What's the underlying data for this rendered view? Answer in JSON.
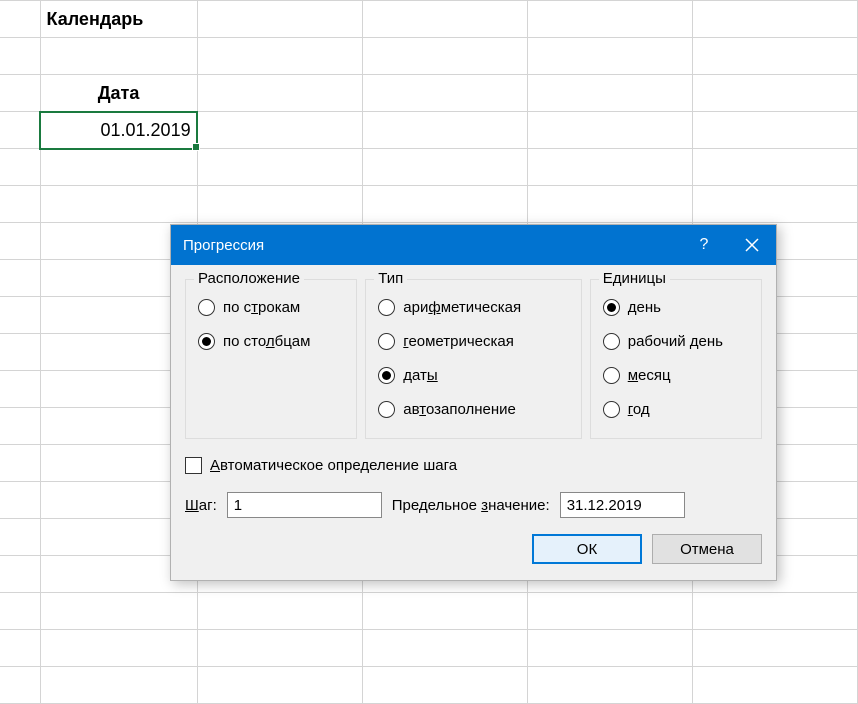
{
  "sheet": {
    "title": "Календарь",
    "header": "Дата",
    "value": "01.01.2019"
  },
  "dialog": {
    "title": "Прогрессия",
    "help": "?",
    "groups": {
      "location": {
        "legend": "Расположение",
        "rows_pre": "по с",
        "rows_u": "т",
        "rows_post": "рокам",
        "cols_pre": "по сто",
        "cols_u": "л",
        "cols_post": "бцам"
      },
      "type": {
        "legend": "Тип",
        "arith_pre": "ари",
        "arith_u": "ф",
        "arith_post": "метическая",
        "geom_u": "г",
        "geom_post": "еометрическая",
        "dates_pre": "дат",
        "dates_u": "ы",
        "auto_pre": "ав",
        "auto_u": "т",
        "auto_post": "озаполнение"
      },
      "units": {
        "legend": "Единицы",
        "day_u": "д",
        "day_post": "ень",
        "weekday": "рабочий день",
        "month_u": "м",
        "month_post": "есяц",
        "year_u": "г",
        "year_post": "од"
      }
    },
    "trend_u": "А",
    "trend_post": "втоматическое определение шага",
    "step_u": "Ш",
    "step_post": "аг:",
    "step_value": "1",
    "stop_pre": "Предельное ",
    "stop_u": "з",
    "stop_post": "начение:",
    "stop_value": "31.12.2019",
    "ok": "ОК",
    "cancel": "Отмена"
  }
}
